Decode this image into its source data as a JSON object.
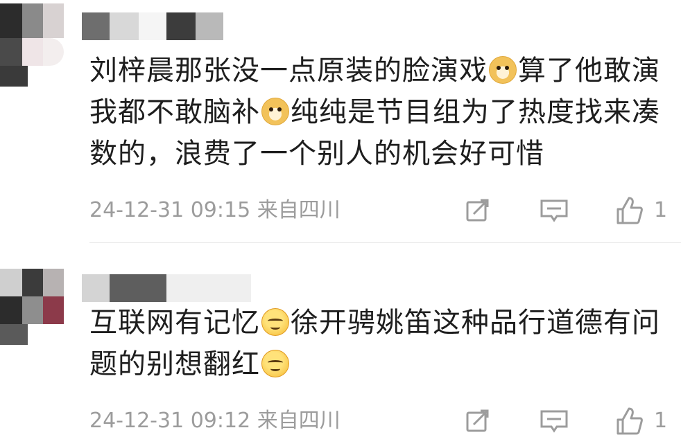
{
  "comments": [
    {
      "text_part1": "刘梓晨那张没一点原装的脸演戏",
      "emoji1": "doge",
      "text_part2": "算了他敢演我都不敢脑补",
      "emoji2": "doge",
      "text_part3": "纯纯是节目组为了热度找来凑数的，浪费了一个别人的机会好可惜",
      "timestamp": "24-12-31 09:15",
      "location": "来自四川",
      "like_count": "1"
    },
    {
      "text_part1": "互联网有记忆",
      "emoji1": "smug",
      "text_part2": "徐开骋姚笛这种品行道德有问题的别想翻红",
      "emoji2": "smug",
      "timestamp": "24-12-31 09:12",
      "location": "来自四川",
      "like_count": "1"
    }
  ],
  "icons": {
    "share": "share-icon",
    "reply": "comment-icon",
    "like": "thumbs-up-icon"
  },
  "colors": {
    "meta": "#9c9c9c",
    "text": "#1e1e1e",
    "divider": "#e8e8e8"
  }
}
